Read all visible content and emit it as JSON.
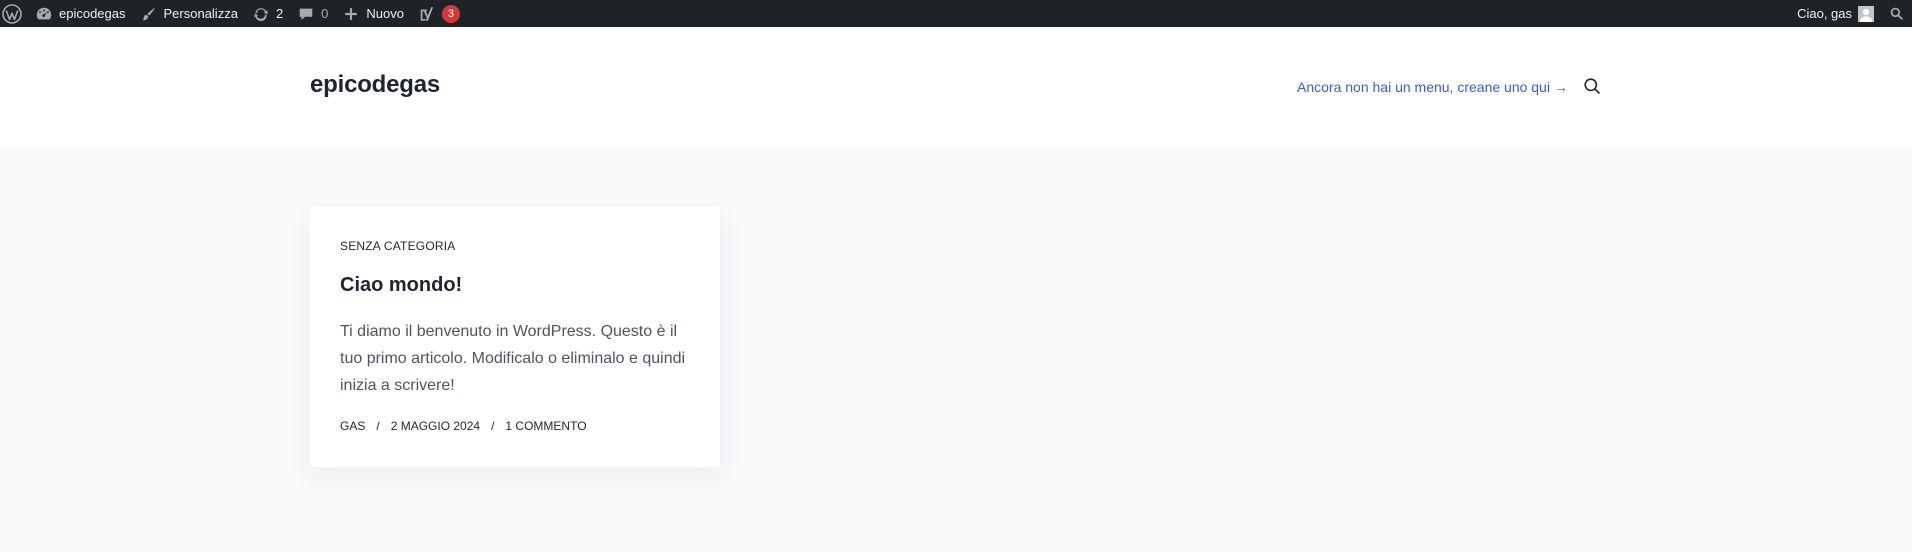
{
  "adminbar": {
    "wp_logo_icon": "wordpress-icon",
    "site_name": "epicodegas",
    "customize_label": "Personalizza",
    "updates_count": "2",
    "comments_count": "0",
    "new_label": "Nuovo",
    "yoast_badge": "3",
    "greeting": "Ciao, gas",
    "search_icon": "search-icon"
  },
  "header": {
    "site_title": "epicodegas",
    "menu_notice": "Ancora non hai un menu, creane uno qui →",
    "search_icon": "search-icon"
  },
  "post": {
    "category": "Senza categoria",
    "title": "Ciao mondo!",
    "excerpt": "Ti diamo il benvenuto in WordPress. Questo è il tuo primo articolo. Modificalo o eliminalo e quindi inizia a scrivere!",
    "author": "gas",
    "separator": "/",
    "date": "2 maggio 2024",
    "comments": "1 commento"
  },
  "colors": {
    "adminbar_bg": "#1d2327",
    "page_bg": "#f8f9fb",
    "link": "#3a5bdb",
    "badge": "#d63638"
  }
}
